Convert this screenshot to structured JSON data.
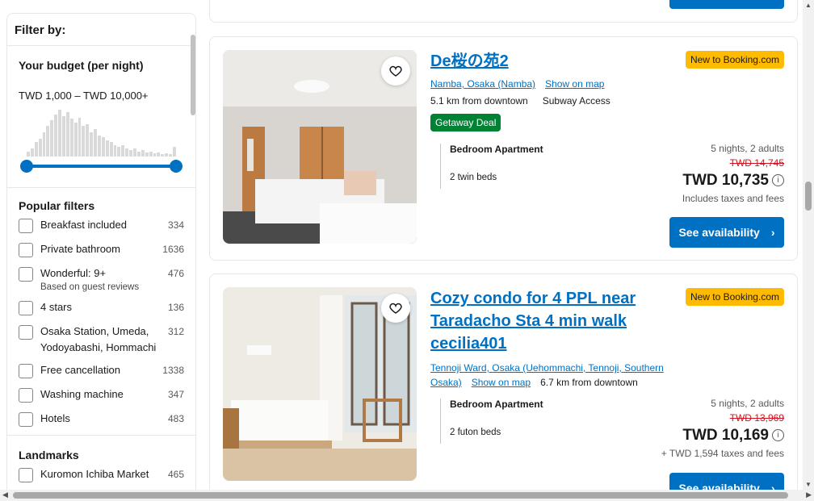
{
  "sidebar": {
    "title": "Filter by:",
    "budget": {
      "heading": "Your budget (per night)",
      "range": "TWD 1,000 – TWD 10,000+"
    },
    "popular": {
      "heading": "Popular filters",
      "items": [
        {
          "label": "Breakfast included",
          "count": "334"
        },
        {
          "label": "Private bathroom",
          "count": "1636"
        },
        {
          "label": "Wonderful: 9+",
          "sub": "Based on guest reviews",
          "count": "476"
        },
        {
          "label": "4 stars",
          "count": "136"
        },
        {
          "label": "Osaka Station, Umeda, Yodoyabashi, Hommachi",
          "count": "312"
        },
        {
          "label": "Free cancellation",
          "count": "1338"
        },
        {
          "label": "Washing machine",
          "count": "347"
        },
        {
          "label": "Hotels",
          "count": "483"
        }
      ]
    },
    "landmarks": {
      "heading": "Landmarks",
      "items": [
        {
          "label": "Kuromon Ichiba Market",
          "count": "465"
        }
      ]
    }
  },
  "cards": [
    {
      "name": "De桜の苑2",
      "location": "Namba, Osaka (Namba)",
      "map_link": "Show on map",
      "distance": "5.1 km from downtown",
      "access": "Subway Access",
      "deal": "Getaway Deal",
      "badge": "New to Booking.com",
      "room_type": "Bedroom Apartment",
      "beds": "2 twin beds",
      "stay": "5 nights, 2 adults",
      "old_price": "TWD 14,745",
      "price": "TWD 10,735",
      "tax": "Includes taxes and fees",
      "button": "See availability"
    },
    {
      "name": "Cozy condo for 4 PPL near Taradacho Sta 4 min walk cecilia401",
      "location": "Tennoji Ward, Osaka (Uehommachi, Tennoji, Southern Osaka)",
      "map_link": "Show on map",
      "distance": "6.7 km from downtown",
      "badge": "New to Booking.com",
      "room_type": "Bedroom Apartment",
      "beds": "2 futon beds",
      "stay": "5 nights, 2 adults",
      "old_price": "TWD 13,969",
      "price": "TWD 10,169",
      "tax": "+ TWD 1,594 taxes and fees",
      "button": "See availability"
    }
  ],
  "icons": {
    "heart": "heart-icon",
    "info": "info-icon",
    "chevron": "chevron-right-icon"
  },
  "colors": {
    "brand_blue": "#0071c2",
    "deal_green": "#008234",
    "badge_yellow": "#febb02",
    "strike_red": "#d4111e"
  }
}
